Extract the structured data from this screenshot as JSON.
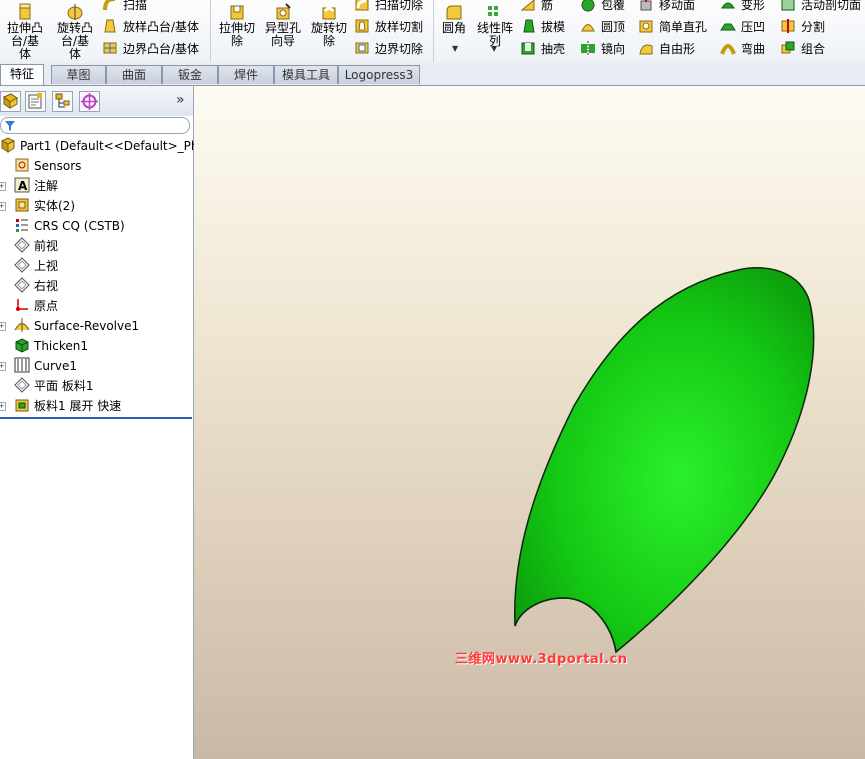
{
  "ribbon": {
    "extrude_boss": "拉伸凸台/基体",
    "revolve_boss": "旋转凸台/基体",
    "sweep": "扫描",
    "loft_boss": "放样凸台/基体",
    "boundary_boss": "边界凸台/基体",
    "extrude_cut": "拉伸切除",
    "hole_wizard": "异型孔向导",
    "revolve_cut": "旋转切除",
    "swept_cut": "扫描切除",
    "lofted_cut": "放样切割",
    "boundary_cut": "边界切除",
    "fillet": "圆角",
    "linear_pattern": "线性阵列",
    "rib": "筋",
    "draft": "拔模",
    "shell": "抽壳",
    "wrap": "包覆",
    "dome": "圆顶",
    "mirror": "镜向",
    "move_face": "移动面",
    "simple_hole": "简单直孔",
    "freeform": "自由形",
    "deform": "变形",
    "indent": "压凹",
    "flex": "弯曲",
    "live_section": "活动剖切面",
    "split": "分割",
    "combine": "组合"
  },
  "tabs": [
    "特征",
    "草图",
    "曲面",
    "钣金",
    "焊件",
    "模具工具",
    "Logopress3"
  ],
  "panel": {
    "collapse_glyph": "»",
    "tree": {
      "root": "Part1  (Default<<Default>_Pho",
      "items": [
        {
          "label": "Sensors",
          "icon": "sensors-icon",
          "expand": false
        },
        {
          "label": "注解",
          "icon": "annotations-icon",
          "expand": true
        },
        {
          "label": "实体(2)",
          "icon": "solid-bodies-icon",
          "expand": true
        },
        {
          "label": "CRS CQ (CSTB)",
          "icon": "material-icon",
          "expand": false
        },
        {
          "label": "前视",
          "icon": "plane-icon",
          "expand": false
        },
        {
          "label": "上视",
          "icon": "plane-icon",
          "expand": false
        },
        {
          "label": "右视",
          "icon": "plane-icon",
          "expand": false
        },
        {
          "label": "原点",
          "icon": "origin-icon",
          "expand": false
        },
        {
          "label": "Surface-Revolve1",
          "icon": "surface-revolve-icon",
          "expand": true
        },
        {
          "label": "Thicken1",
          "icon": "thicken-icon",
          "expand": false
        },
        {
          "label": "Curve1",
          "icon": "curve-icon",
          "expand": true
        },
        {
          "label": "平面 板料1",
          "icon": "plane-icon",
          "expand": false
        },
        {
          "label": "板料1 展开 快速",
          "icon": "sheet-flatten-icon",
          "expand": true
        }
      ]
    }
  },
  "watermark": "三维网www.3dportal.cn",
  "colors": {
    "part_green": "#19c419",
    "accent": "#2a5fb0"
  }
}
